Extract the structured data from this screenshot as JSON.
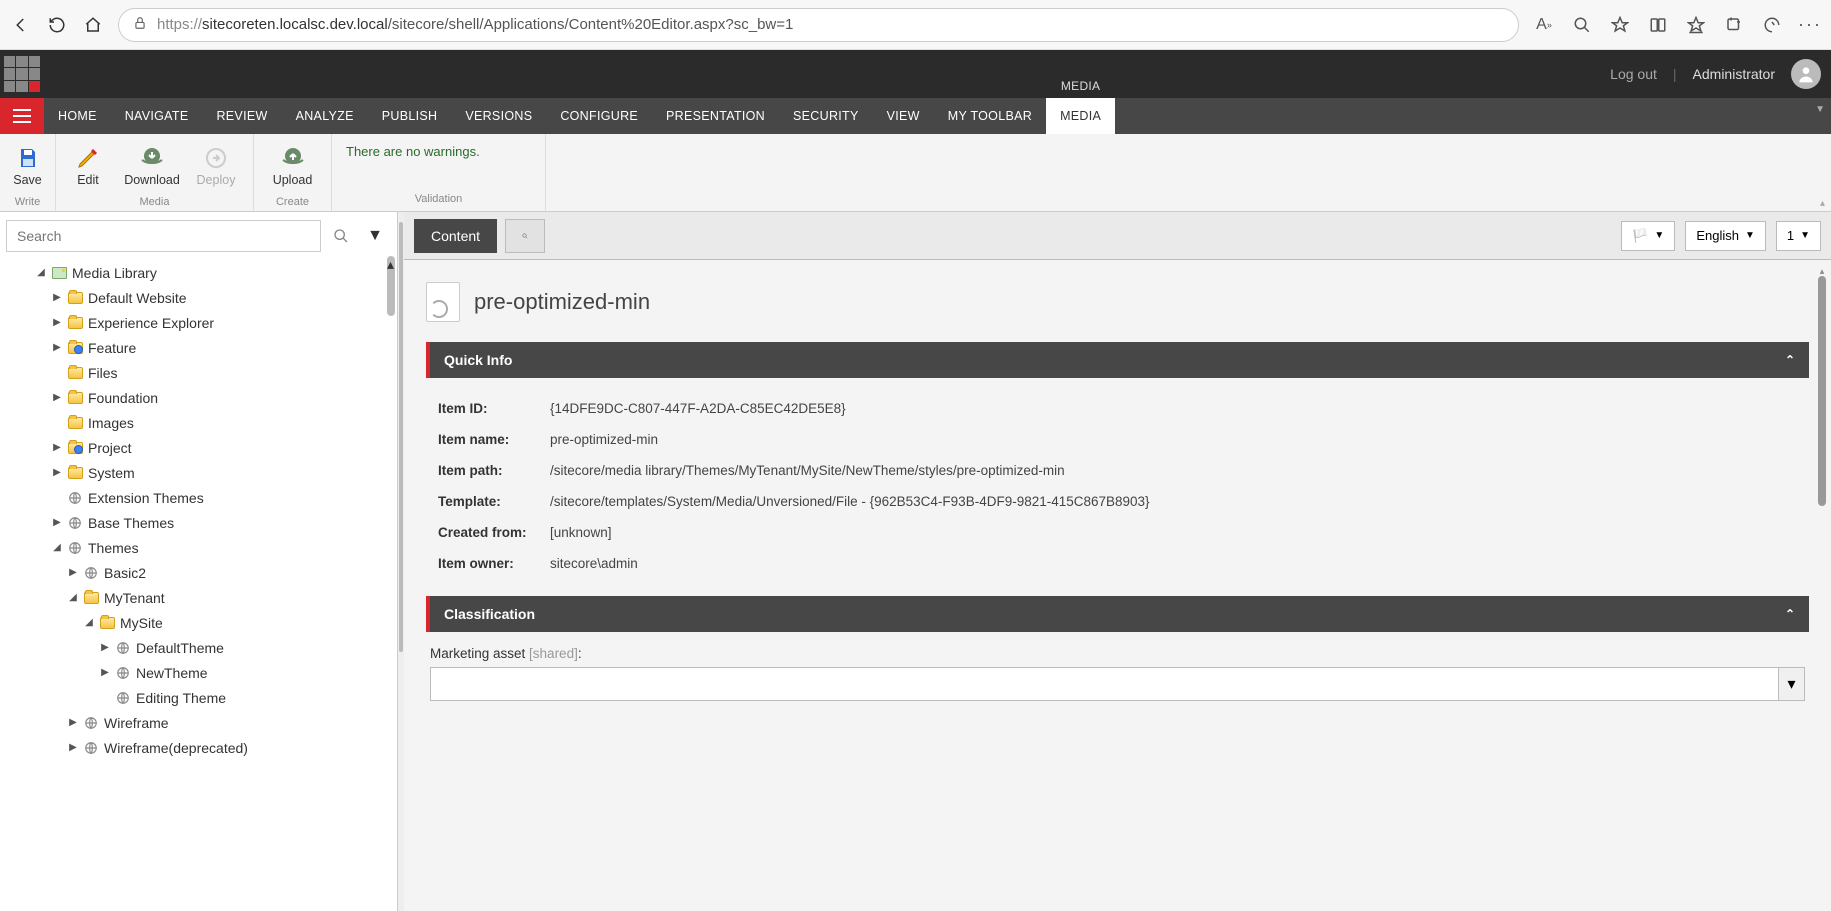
{
  "browser": {
    "url_prefix": "https://",
    "url_host": "sitecoreten.localsc.dev.local",
    "url_path": "/sitecore/shell/Applications/Content%20Editor.aspx?sc_bw=1"
  },
  "header": {
    "logout": "Log out",
    "user": "Administrator"
  },
  "ribbon": {
    "supertab": "Media",
    "tabs": [
      "HOME",
      "NAVIGATE",
      "REVIEW",
      "ANALYZE",
      "PUBLISH",
      "VERSIONS",
      "CONFIGURE",
      "PRESENTATION",
      "SECURITY",
      "VIEW",
      "MY TOOLBAR",
      "MEDIA"
    ],
    "active_tab": "MEDIA",
    "groups": {
      "write": {
        "label": "Write",
        "save": "Save"
      },
      "media": {
        "label": "Media",
        "edit": "Edit",
        "download": "Download",
        "deploy": "Deploy"
      },
      "create": {
        "label": "Create",
        "upload": "Upload"
      },
      "validation": {
        "label": "Validation",
        "message": "There are no warnings."
      }
    }
  },
  "search": {
    "placeholder": "Search"
  },
  "tree": {
    "root": "Media Library",
    "nodes": [
      {
        "label": "Default Website",
        "icon": "folder",
        "arrow": "right",
        "depth": 1
      },
      {
        "label": "Experience Explorer",
        "icon": "folder",
        "arrow": "right",
        "depth": 1
      },
      {
        "label": "Feature",
        "icon": "folder-blue",
        "arrow": "right",
        "depth": 1
      },
      {
        "label": "Files",
        "icon": "folder",
        "arrow": "none",
        "depth": 1
      },
      {
        "label": "Foundation",
        "icon": "folder",
        "arrow": "right",
        "depth": 1
      },
      {
        "label": "Images",
        "icon": "folder",
        "arrow": "none",
        "depth": 1
      },
      {
        "label": "Project",
        "icon": "folder-blue",
        "arrow": "right",
        "depth": 1
      },
      {
        "label": "System",
        "icon": "folder",
        "arrow": "right",
        "depth": 1
      },
      {
        "label": "Extension Themes",
        "icon": "theme",
        "arrow": "none",
        "depth": 1
      },
      {
        "label": "Base Themes",
        "icon": "theme",
        "arrow": "right",
        "depth": 1
      },
      {
        "label": "Themes",
        "icon": "theme",
        "arrow": "down",
        "depth": 1
      },
      {
        "label": "Basic2",
        "icon": "theme",
        "arrow": "right",
        "depth": 2
      },
      {
        "label": "MyTenant",
        "icon": "folder",
        "arrow": "down",
        "depth": 2
      },
      {
        "label": "MySite",
        "icon": "folder",
        "arrow": "down",
        "depth": 3
      },
      {
        "label": "DefaultTheme",
        "icon": "theme",
        "arrow": "right",
        "depth": 4
      },
      {
        "label": "NewTheme",
        "icon": "theme",
        "arrow": "right",
        "depth": 4
      },
      {
        "label": "Editing Theme",
        "icon": "theme",
        "arrow": "none",
        "depth": 4
      },
      {
        "label": "Wireframe",
        "icon": "theme",
        "arrow": "right",
        "depth": 2
      },
      {
        "label": "Wireframe(deprecated)",
        "icon": "theme",
        "arrow": "right",
        "depth": 2
      }
    ]
  },
  "content_tabs": {
    "content": "Content",
    "language": "English",
    "version": "1"
  },
  "item": {
    "title": "pre-optimized-min",
    "quick_info_label": "Quick Info",
    "fields": [
      {
        "k": "Item ID:",
        "v": "{14DFE9DC-C807-447F-A2DA-C85EC42DE5E8}"
      },
      {
        "k": "Item name:",
        "v": "pre-optimized-min"
      },
      {
        "k": "Item path:",
        "v": "/sitecore/media library/Themes/MyTenant/MySite/NewTheme/styles/pre-optimized-min"
      },
      {
        "k": "Template:",
        "v": "/sitecore/templates/System/Media/Unversioned/File - {962B53C4-F93B-4DF9-9821-415C867B8903}"
      },
      {
        "k": "Created from:",
        "v": "[unknown]"
      },
      {
        "k": "Item owner:",
        "v": "sitecore\\admin"
      }
    ],
    "classification_label": "Classification",
    "marketing_asset_label": "Marketing asset ",
    "marketing_asset_shared": "[shared]",
    "marketing_asset_colon": ":"
  }
}
